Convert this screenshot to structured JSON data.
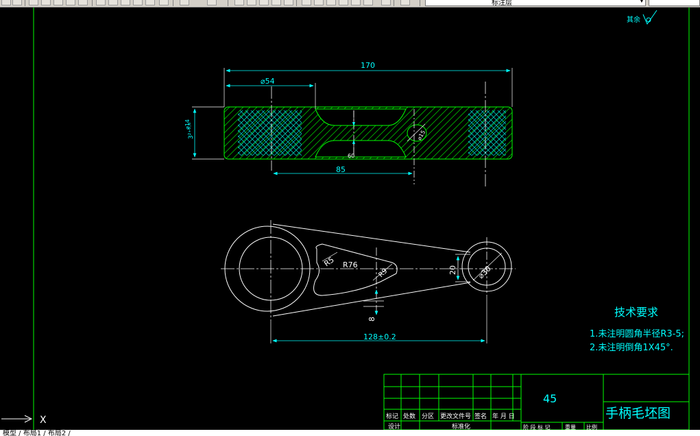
{
  "app": {
    "layer_name": "标注层",
    "command_text": "模型 / 布局1 / 布局2 /"
  },
  "colors": {
    "outline": "#ffffff",
    "dimension": "#00ffff",
    "hatch": "#00c000",
    "frame": "#00ff00",
    "text": "#00ffff"
  },
  "drawing": {
    "dims": {
      "overall_length": "170",
      "diameter_left": "⌀54",
      "center_distance": "85",
      "thickness": "3²⁺⁰·⁶",
      "hole_dia": "⌀14",
      "groove_depth": "60",
      "bottom_offset": "⌀15",
      "r5": "R5",
      "r76": "R76",
      "r9": "R9",
      "height_20": "20",
      "dia_30": "⌀30",
      "w_8": "8",
      "span": "128±0.2"
    },
    "roughness_label": "其余",
    "tech_title": "技术要求",
    "tech_notes": [
      "1.未注明圆角半径R3-5;",
      "2.未注明倒角1X45°."
    ]
  },
  "titleblock": {
    "material": "45",
    "drawing_title": "手柄毛坯图",
    "headers": [
      "标记",
      "处数",
      "分区",
      "更改文件号",
      "签名",
      "年 月 日"
    ],
    "row2": [
      "设计",
      "标准化"
    ],
    "stage_row": [
      "阶 段 标 记",
      "重量",
      "比例"
    ]
  },
  "ucs": {
    "x_label": "X"
  }
}
